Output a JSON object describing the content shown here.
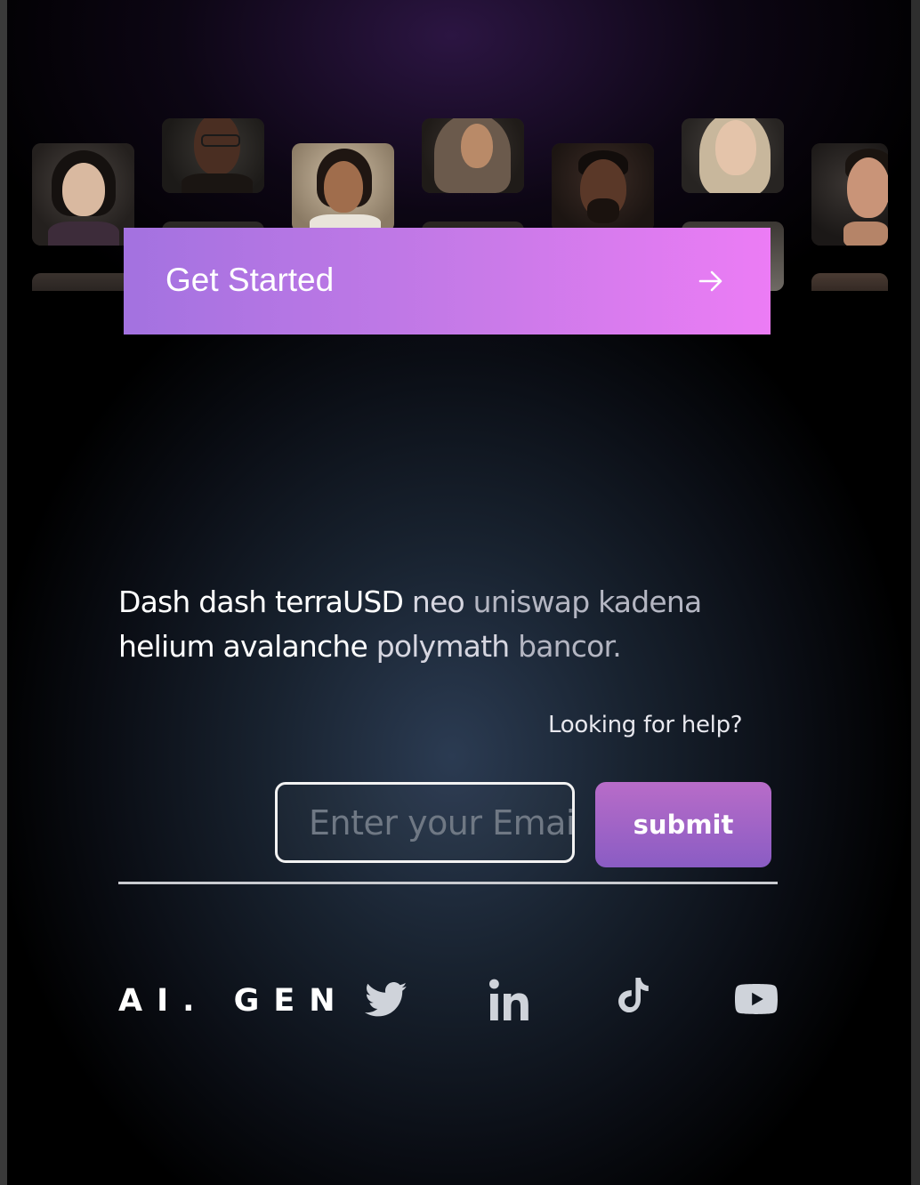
{
  "hero": {
    "portraits": [
      {
        "name": "portrait-woman-east-asian"
      },
      {
        "name": "portrait-man-glasses"
      },
      {
        "name": "portrait-woman-south-asian"
      },
      {
        "name": "portrait-woman-headscarf"
      },
      {
        "name": "portrait-man-beard"
      },
      {
        "name": "portrait-woman-blonde"
      },
      {
        "name": "portrait-man-stubble"
      }
    ],
    "cta_label": "Get Started",
    "cta_icon": "arrow-right-icon",
    "colors": {
      "cta_gradient_start": "#a372e0",
      "cta_gradient_end": "#ec7cf5"
    }
  },
  "tagline": {
    "words": [
      {
        "text": "Dash",
        "tone": "w"
      },
      {
        "text": "dash",
        "tone": "w"
      },
      {
        "text": "terraUSD",
        "tone": "w"
      },
      {
        "text": "neo",
        "tone": "dim1"
      },
      {
        "text": "uniswap",
        "tone": "dim2"
      },
      {
        "text": "kadena",
        "tone": "dim2"
      },
      {
        "text": "helium",
        "tone": "w"
      },
      {
        "text": "avalanche",
        "tone": "w"
      },
      {
        "text": "polymath",
        "tone": "dim1"
      },
      {
        "text": "bancor.",
        "tone": "dim2"
      }
    ]
  },
  "help": {
    "label": "Looking for help?"
  },
  "subscribe": {
    "email_placeholder": "Enter your Email",
    "submit_label": "submit",
    "colors": {
      "submit_gradient_top": "#b86cc8",
      "submit_gradient_bottom": "#8a5cc4"
    }
  },
  "footer": {
    "brand": "AI. GEN",
    "social": [
      {
        "name": "twitter-icon"
      },
      {
        "name": "linkedin-icon"
      },
      {
        "name": "tiktok-icon"
      },
      {
        "name": "youtube-icon"
      }
    ]
  }
}
